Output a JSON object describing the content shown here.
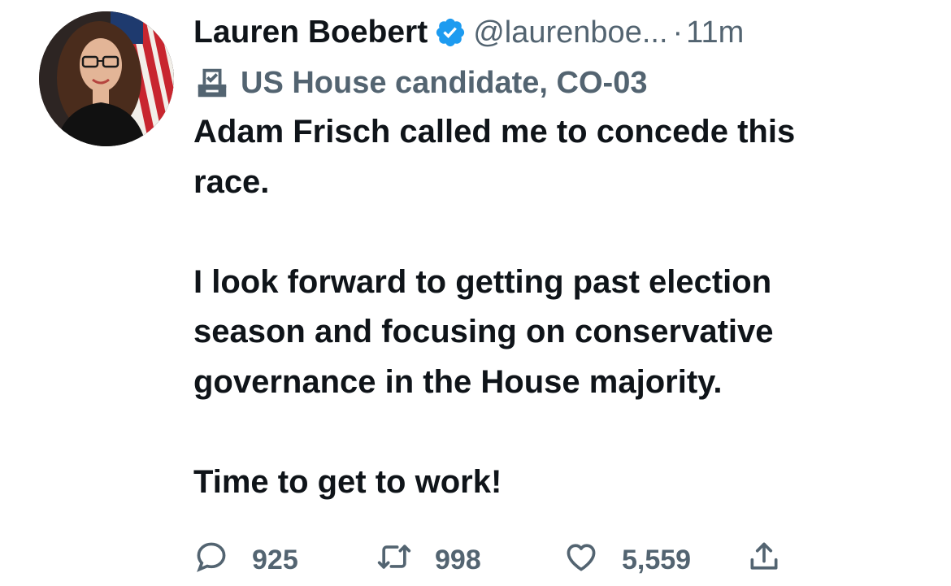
{
  "tweet": {
    "author": {
      "display_name": "Lauren Boebert",
      "handle": "@laurenboe...",
      "verified_icon": "verified-badge-icon",
      "accent_color": "#1d9bf0"
    },
    "separator": "·",
    "timestamp": "11m",
    "label": {
      "icon": "ballot-box-icon",
      "text": "US House candidate, CO-03"
    },
    "text": "Adam Frisch called me to concede this\nrace.\n\nI look forward to getting past election\nseason and focusing on conservative\ngovernance in the House majority.\n\nTime to get to work!",
    "actions": {
      "reply": {
        "icon": "reply-icon",
        "count": "925"
      },
      "retweet": {
        "icon": "retweet-icon",
        "count": "998"
      },
      "like": {
        "icon": "heart-icon",
        "count": "5,559"
      },
      "share": {
        "icon": "share-icon"
      }
    },
    "colors": {
      "text_primary": "#0f1419",
      "text_secondary": "#536471"
    }
  }
}
